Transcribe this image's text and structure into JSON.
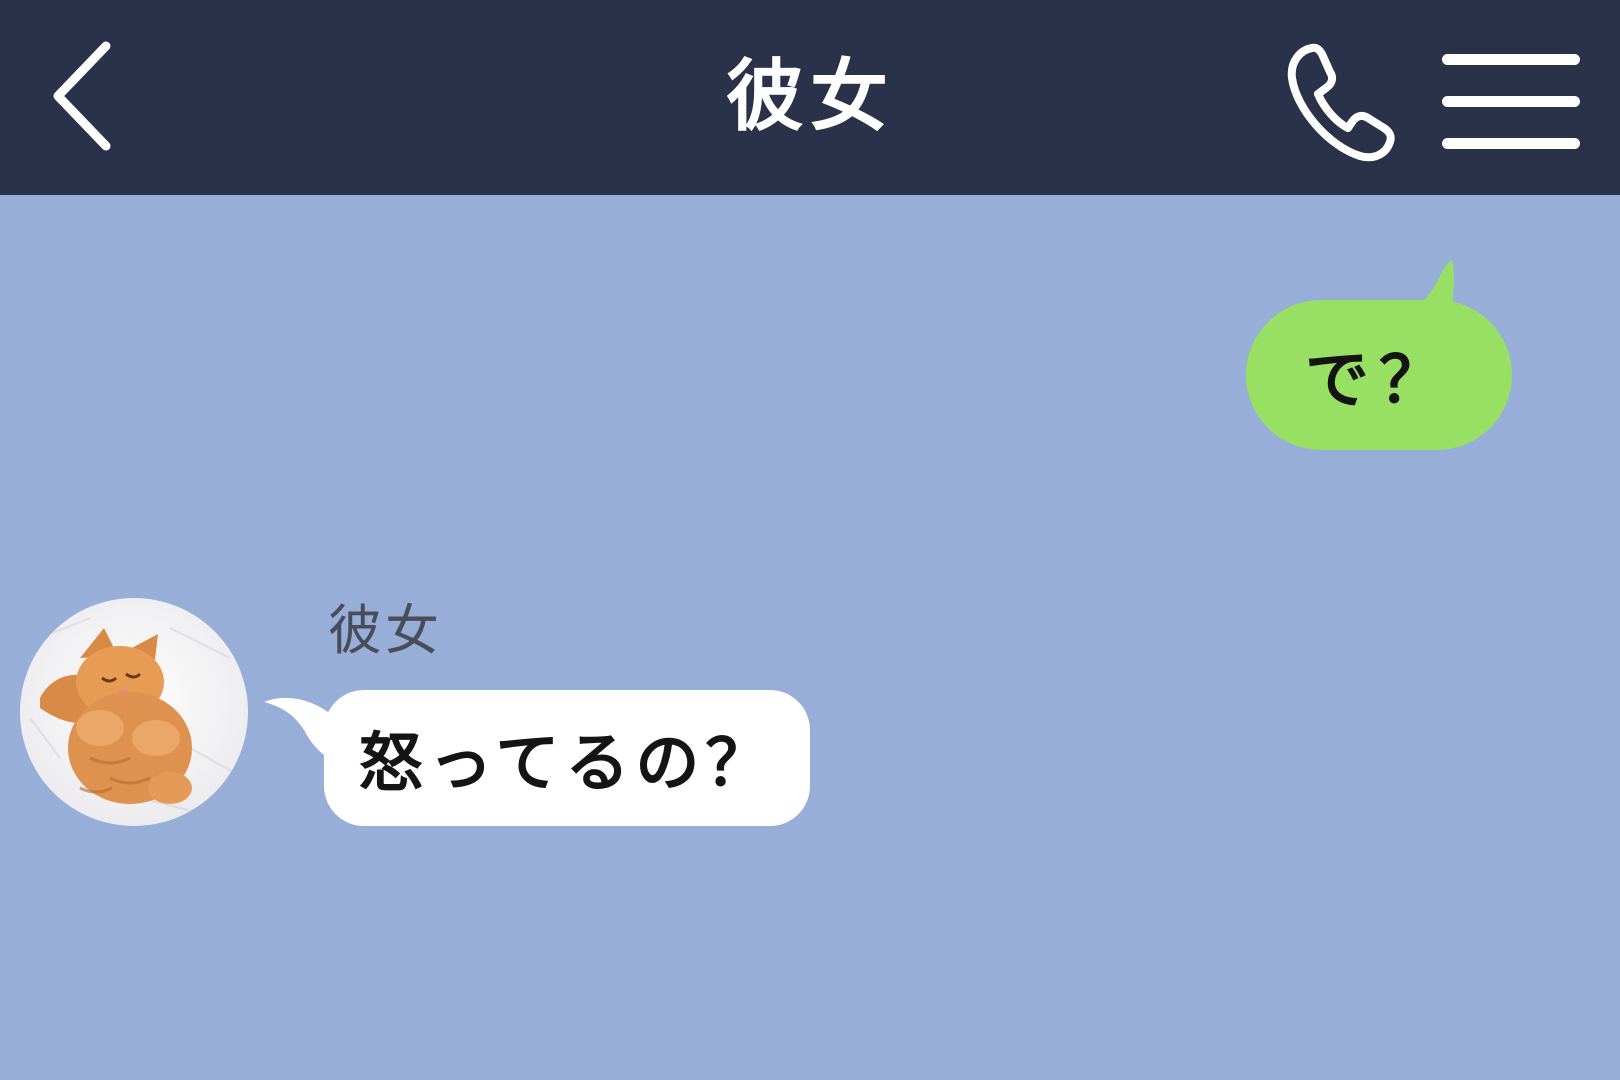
{
  "header": {
    "title": "彼女",
    "back_icon": "chevron-left-icon",
    "call_icon": "phone-icon",
    "menu_icon": "hamburger-menu-icon"
  },
  "messages": [
    {
      "direction": "outgoing",
      "text": "で？"
    },
    {
      "direction": "incoming",
      "sender": "彼女",
      "text": "怒ってるの？",
      "avatar": "kitten-avatar"
    }
  ],
  "colors": {
    "header_bg": "#293248",
    "chat_bg": "#97aed8",
    "outgoing_bubble": "#98e063",
    "incoming_bubble": "#ffffff"
  }
}
